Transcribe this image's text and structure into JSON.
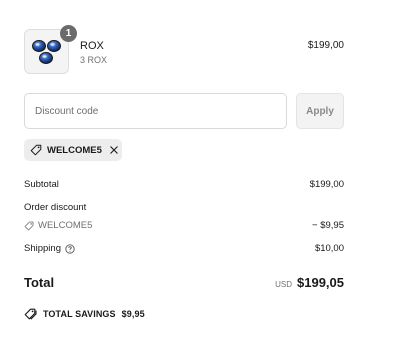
{
  "product": {
    "name": "ROX",
    "variant": "3 ROX",
    "price": "$199,00",
    "quantity": "1",
    "image_icon": "blue-gem-stones"
  },
  "discount": {
    "placeholder": "Discount code",
    "apply_label": "Apply",
    "applied_code": "WELCOME5",
    "tag_icon": "tag-icon",
    "remove_icon": "close-icon"
  },
  "summary": {
    "subtotal_label": "Subtotal",
    "subtotal_value": "$199,00",
    "order_discount_label": "Order discount",
    "order_discount_code": "WELCOME5",
    "order_discount_value": "− $9,95",
    "shipping_label": "Shipping",
    "shipping_value": "$10,00",
    "shipping_help_icon": "question-circle-icon"
  },
  "total": {
    "label": "Total",
    "currency": "USD",
    "amount": "$199,05"
  },
  "savings": {
    "label": "TOTAL SAVINGS",
    "amount": "$9,95"
  },
  "colors": {
    "text": "#1a1a1a",
    "muted": "#707070",
    "chip_bg": "#ededed",
    "badge_bg": "#6b6b6b",
    "gem": "#2f5fb8"
  }
}
